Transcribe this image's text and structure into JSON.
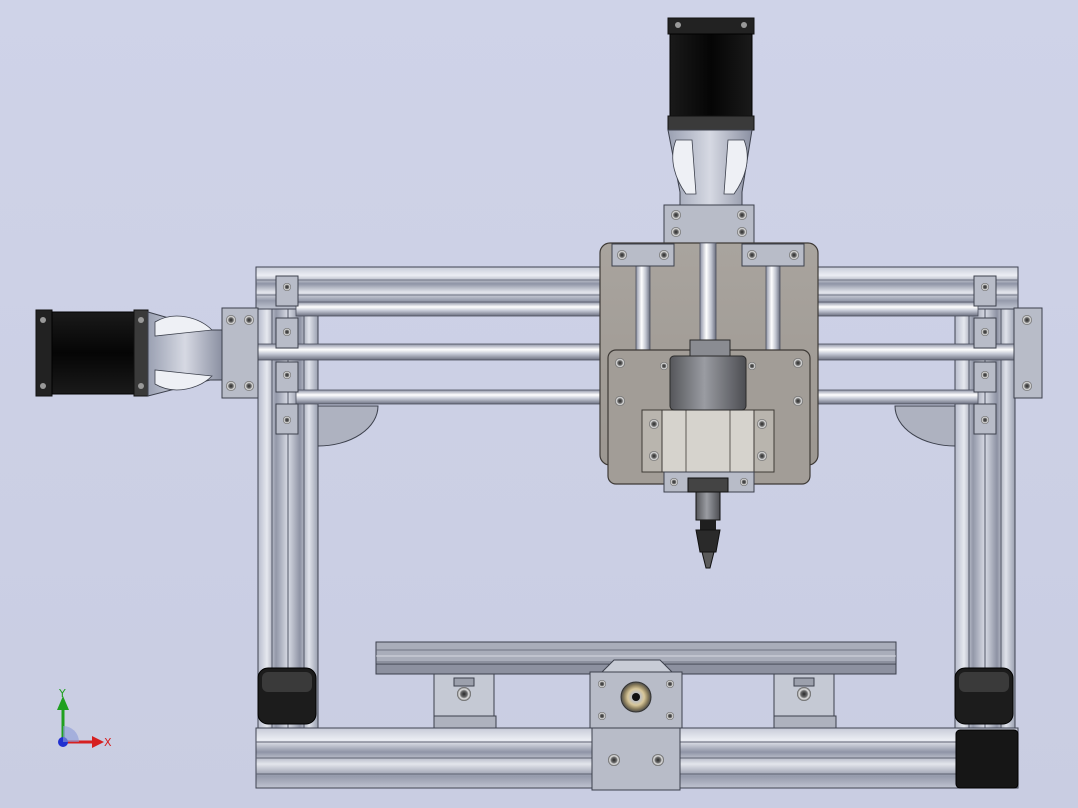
{
  "scene": {
    "background_color": "#cdd1e6",
    "model": "cnc-router-3-axis"
  },
  "triad": {
    "x_label": "X",
    "y_label": "Y",
    "x_color": "#d62020",
    "y_color": "#20a020",
    "z_color": "#2030d0"
  }
}
